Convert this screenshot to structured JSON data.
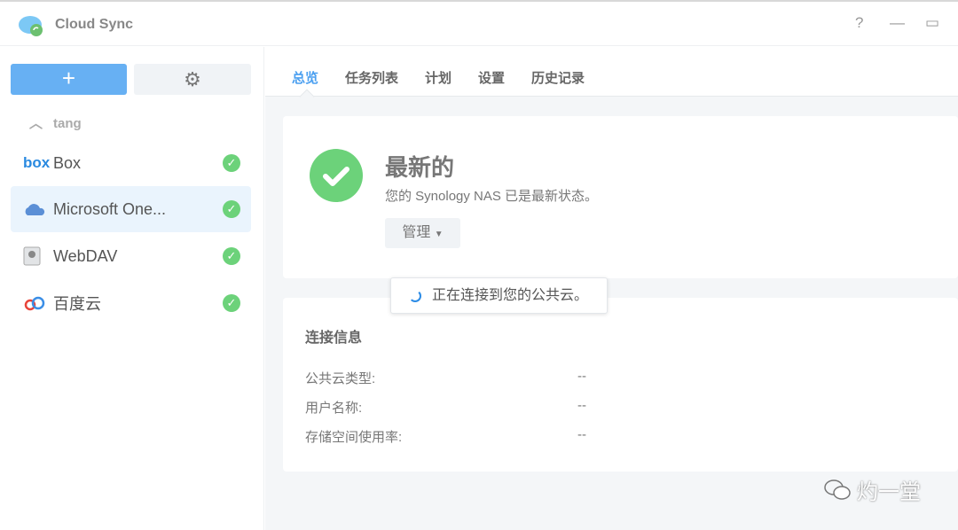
{
  "app": {
    "title": "Cloud Sync",
    "help": "?",
    "minimize": "—",
    "maximize": "▭"
  },
  "sidebar": {
    "add": "+",
    "settings": "⚙",
    "group": "tang",
    "items": [
      {
        "label": "Box",
        "icon": "box-logo",
        "status": "✓"
      },
      {
        "label": "Microsoft One...",
        "icon": "onedrive-icon",
        "status": "✓"
      },
      {
        "label": "WebDAV",
        "icon": "webdav-server-icon",
        "status": "✓"
      },
      {
        "label": "百度云",
        "icon": "baidu-cloud-icon",
        "status": "✓"
      }
    ]
  },
  "tabs": [
    "总览",
    "任务列表",
    "计划",
    "设置",
    "历史记录"
  ],
  "overview": {
    "title": "最新的",
    "desc": "您的 Synology NAS 已是最新状态。",
    "manage": "管理"
  },
  "connection": {
    "title": "连接信息",
    "rows": [
      {
        "label": "公共云类型:",
        "value": "--"
      },
      {
        "label": "用户名称:",
        "value": "--"
      },
      {
        "label": "存储空间使用率:",
        "value": "--"
      }
    ]
  },
  "toast": "正在连接到您的公共云。",
  "watermark": "灼一堂",
  "colors": {
    "accent": "#4a9ff0",
    "success": "#6cd27a"
  }
}
